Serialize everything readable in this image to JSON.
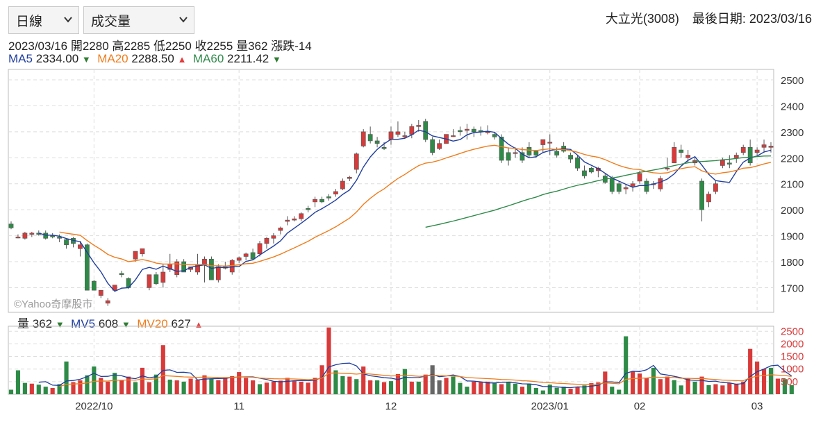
{
  "controls": {
    "period_select": "日線",
    "indicator_select": "成交量"
  },
  "header": {
    "stock": "大立光(3008)",
    "last_date": "最後日期: 2023/03/16"
  },
  "ohlc_line": {
    "date": "2023/03/16",
    "open": "開2280",
    "high": "高2285",
    "low": "低2250",
    "close": "收2255",
    "volume": "量362",
    "change": "漲跌-14"
  },
  "ma_line": {
    "ma5_label": "MA5",
    "ma5_value": "2334.00",
    "ma5_dir": "▼",
    "ma20_label": "MA20",
    "ma20_value": "2288.50",
    "ma20_dir": "▲",
    "ma60_label": "MA60",
    "ma60_value": "2211.42",
    "ma60_dir": "▼"
  },
  "vol_line": {
    "vol_label": "量",
    "vol_value": "362",
    "vol_dir": "▼",
    "mv5_label": "MV5",
    "mv5_value": "608",
    "mv5_dir": "▼",
    "mv20_label": "MV20",
    "mv20_value": "627",
    "mv20_dir": "▲"
  },
  "watermark": "©Yahoo奇摩股市",
  "colors": {
    "up": "#d83a3a",
    "down": "#2e8b47",
    "flat": "#666666",
    "ma5": "#1f3e9e",
    "ma20": "#f07c1b",
    "ma60": "#2f8a4a",
    "grid": "#dddddd"
  },
  "chart_data": {
    "type": "candlestick",
    "price_axis": {
      "ticks": [
        1700,
        1800,
        1900,
        2000,
        2100,
        2200,
        2300,
        2400,
        2500
      ],
      "range": [
        1605,
        2540
      ]
    },
    "volume_axis": {
      "ticks": [
        500,
        1000,
        1500,
        2000,
        2500
      ],
      "range": [
        0,
        2700
      ]
    },
    "x_labels": [
      {
        "label": "2022/10",
        "index": 12
      },
      {
        "label": "11",
        "index": 33
      },
      {
        "label": "12",
        "index": 55
      },
      {
        "label": "2023/01",
        "index": 78
      },
      {
        "label": "02",
        "index": 91
      },
      {
        "label": "03",
        "index": 108
      }
    ],
    "candles": [
      {
        "o": 1945,
        "h": 1955,
        "l": 1925,
        "c": 1930
      },
      {
        "o": 1895,
        "h": 1905,
        "l": 1890,
        "c": 1895
      },
      {
        "o": 1890,
        "h": 1915,
        "l": 1885,
        "c": 1910
      },
      {
        "o": 1905,
        "h": 1915,
        "l": 1895,
        "c": 1910
      },
      {
        "o": 1910,
        "h": 1920,
        "l": 1900,
        "c": 1905
      },
      {
        "o": 1910,
        "h": 1920,
        "l": 1885,
        "c": 1890
      },
      {
        "o": 1900,
        "h": 1910,
        "l": 1890,
        "c": 1895
      },
      {
        "o": 1895,
        "h": 1905,
        "l": 1875,
        "c": 1890
      },
      {
        "o": 1885,
        "h": 1890,
        "l": 1850,
        "c": 1865
      },
      {
        "o": 1890,
        "h": 1895,
        "l": 1855,
        "c": 1870
      },
      {
        "o": 1850,
        "h": 1880,
        "l": 1820,
        "c": 1865
      },
      {
        "o": 1865,
        "h": 1870,
        "l": 1690,
        "c": 1690
      },
      {
        "o": 1725,
        "h": 1730,
        "l": 1690,
        "c": 1690
      },
      {
        "o": 1670,
        "h": 1690,
        "l": 1660,
        "c": 1690
      },
      {
        "o": 1640,
        "h": 1660,
        "l": 1630,
        "c": 1650
      },
      {
        "o": 1690,
        "h": 1710,
        "l": 1685,
        "c": 1710
      },
      {
        "o": 1755,
        "h": 1765,
        "l": 1740,
        "c": 1750
      },
      {
        "o": 1735,
        "h": 1740,
        "l": 1695,
        "c": 1700
      },
      {
        "o": 1810,
        "h": 1840,
        "l": 1800,
        "c": 1840
      },
      {
        "o": 1830,
        "h": 1850,
        "l": 1820,
        "c": 1850
      },
      {
        "o": 1700,
        "h": 1740,
        "l": 1690,
        "c": 1750
      },
      {
        "o": 1750,
        "h": 1760,
        "l": 1710,
        "c": 1715
      },
      {
        "o": 1720,
        "h": 1790,
        "l": 1700,
        "c": 1760
      },
      {
        "o": 1770,
        "h": 1830,
        "l": 1760,
        "c": 1790
      },
      {
        "o": 1750,
        "h": 1810,
        "l": 1740,
        "c": 1800
      },
      {
        "o": 1800,
        "h": 1810,
        "l": 1760,
        "c": 1760
      },
      {
        "o": 1770,
        "h": 1780,
        "l": 1760,
        "c": 1780
      },
      {
        "o": 1760,
        "h": 1830,
        "l": 1750,
        "c": 1790
      },
      {
        "o": 1790,
        "h": 1820,
        "l": 1720,
        "c": 1810
      },
      {
        "o": 1810,
        "h": 1820,
        "l": 1730,
        "c": 1730
      },
      {
        "o": 1730,
        "h": 1790,
        "l": 1720,
        "c": 1780
      },
      {
        "o": 1780,
        "h": 1800,
        "l": 1770,
        "c": 1775
      },
      {
        "o": 1760,
        "h": 1810,
        "l": 1750,
        "c": 1805
      },
      {
        "o": 1805,
        "h": 1820,
        "l": 1795,
        "c": 1815
      },
      {
        "o": 1820,
        "h": 1835,
        "l": 1805,
        "c": 1830
      },
      {
        "o": 1835,
        "h": 1850,
        "l": 1805,
        "c": 1810
      },
      {
        "o": 1830,
        "h": 1880,
        "l": 1820,
        "c": 1870
      },
      {
        "o": 1870,
        "h": 1895,
        "l": 1850,
        "c": 1890
      },
      {
        "o": 1890,
        "h": 1910,
        "l": 1870,
        "c": 1900
      },
      {
        "o": 1920,
        "h": 1935,
        "l": 1905,
        "c": 1930
      },
      {
        "o": 1955,
        "h": 1975,
        "l": 1940,
        "c": 1960
      },
      {
        "o": 1960,
        "h": 1975,
        "l": 1955,
        "c": 1965
      },
      {
        "o": 1965,
        "h": 1990,
        "l": 1955,
        "c": 1985
      },
      {
        "o": 2005,
        "h": 2015,
        "l": 1990,
        "c": 2000
      },
      {
        "o": 2030,
        "h": 2050,
        "l": 2010,
        "c": 2040
      },
      {
        "o": 2040,
        "h": 2050,
        "l": 2025,
        "c": 2030
      },
      {
        "o": 2050,
        "h": 2060,
        "l": 2035,
        "c": 2045
      },
      {
        "o": 2060,
        "h": 2080,
        "l": 2050,
        "c": 2070
      },
      {
        "o": 2080,
        "h": 2120,
        "l": 2075,
        "c": 2110
      },
      {
        "o": 2120,
        "h": 2130,
        "l": 2110,
        "c": 2125
      },
      {
        "o": 2155,
        "h": 2220,
        "l": 2140,
        "c": 2215
      },
      {
        "o": 2245,
        "h": 2310,
        "l": 2240,
        "c": 2300
      },
      {
        "o": 2290,
        "h": 2320,
        "l": 2255,
        "c": 2265
      },
      {
        "o": 2265,
        "h": 2280,
        "l": 2240,
        "c": 2255
      },
      {
        "o": 2240,
        "h": 2260,
        "l": 2230,
        "c": 2235
      },
      {
        "o": 2270,
        "h": 2320,
        "l": 2250,
        "c": 2300
      },
      {
        "o": 2290,
        "h": 2340,
        "l": 2280,
        "c": 2300
      },
      {
        "o": 2280,
        "h": 2300,
        "l": 2275,
        "c": 2285
      },
      {
        "o": 2290,
        "h": 2330,
        "l": 2275,
        "c": 2320
      },
      {
        "o": 2320,
        "h": 2345,
        "l": 2300,
        "c": 2325
      },
      {
        "o": 2340,
        "h": 2350,
        "l": 2260,
        "c": 2270
      },
      {
        "o": 2270,
        "h": 2280,
        "l": 2210,
        "c": 2220
      },
      {
        "o": 2235,
        "h": 2270,
        "l": 2230,
        "c": 2255
      },
      {
        "o": 2255,
        "h": 2290,
        "l": 2255,
        "c": 2290
      },
      {
        "o": 2285,
        "h": 2310,
        "l": 2280,
        "c": 2285
      },
      {
        "o": 2305,
        "h": 2320,
        "l": 2285,
        "c": 2300
      },
      {
        "o": 2305,
        "h": 2330,
        "l": 2270,
        "c": 2310
      },
      {
        "o": 2310,
        "h": 2320,
        "l": 2280,
        "c": 2300
      },
      {
        "o": 2305,
        "h": 2320,
        "l": 2285,
        "c": 2300
      },
      {
        "o": 2300,
        "h": 2325,
        "l": 2290,
        "c": 2300
      },
      {
        "o": 2290,
        "h": 2300,
        "l": 2270,
        "c": 2280
      },
      {
        "o": 2280,
        "h": 2290,
        "l": 2180,
        "c": 2190
      },
      {
        "o": 2220,
        "h": 2240,
        "l": 2170,
        "c": 2190
      },
      {
        "o": 2220,
        "h": 2240,
        "l": 2200,
        "c": 2220
      },
      {
        "o": 2220,
        "h": 2240,
        "l": 2180,
        "c": 2190
      },
      {
        "o": 2240,
        "h": 2260,
        "l": 2200,
        "c": 2210
      },
      {
        "o": 2225,
        "h": 2230,
        "l": 2200,
        "c": 2210
      },
      {
        "o": 2250,
        "h": 2270,
        "l": 2220,
        "c": 2270
      },
      {
        "o": 2260,
        "h": 2290,
        "l": 2210,
        "c": 2260
      },
      {
        "o": 2225,
        "h": 2240,
        "l": 2200,
        "c": 2210
      },
      {
        "o": 2245,
        "h": 2260,
        "l": 2220,
        "c": 2225
      },
      {
        "o": 2210,
        "h": 2220,
        "l": 2180,
        "c": 2195
      },
      {
        "o": 2200,
        "h": 2210,
        "l": 2150,
        "c": 2160
      },
      {
        "o": 2150,
        "h": 2170,
        "l": 2120,
        "c": 2130
      },
      {
        "o": 2160,
        "h": 2165,
        "l": 2140,
        "c": 2145
      },
      {
        "o": 2150,
        "h": 2165,
        "l": 2125,
        "c": 2160
      },
      {
        "o": 2130,
        "h": 2140,
        "l": 2100,
        "c": 2105
      },
      {
        "o": 2120,
        "h": 2130,
        "l": 2060,
        "c": 2070
      },
      {
        "o": 2100,
        "h": 2110,
        "l": 2060,
        "c": 2070
      },
      {
        "o": 2080,
        "h": 2100,
        "l": 2060,
        "c": 2085
      },
      {
        "o": 2090,
        "h": 2110,
        "l": 2070,
        "c": 2100
      },
      {
        "o": 2110,
        "h": 2150,
        "l": 2100,
        "c": 2140
      },
      {
        "o": 2110,
        "h": 2120,
        "l": 2060,
        "c": 2070
      },
      {
        "o": 2100,
        "h": 2110,
        "l": 2080,
        "c": 2100
      },
      {
        "o": 2080,
        "h": 2130,
        "l": 2070,
        "c": 2120
      },
      {
        "o": 2160,
        "h": 2200,
        "l": 2150,
        "c": 2160
      },
      {
        "o": 2180,
        "h": 2260,
        "l": 2180,
        "c": 2240
      },
      {
        "o": 2230,
        "h": 2250,
        "l": 2200,
        "c": 2220
      },
      {
        "o": 2200,
        "h": 2230,
        "l": 2180,
        "c": 2210
      },
      {
        "o": 2180,
        "h": 2200,
        "l": 2170,
        "c": 2190
      },
      {
        "o": 2110,
        "h": 2120,
        "l": 1955,
        "c": 2000
      },
      {
        "o": 2030,
        "h": 2070,
        "l": 2010,
        "c": 2060
      },
      {
        "o": 2070,
        "h": 2110,
        "l": 2060,
        "c": 2100
      },
      {
        "o": 2170,
        "h": 2200,
        "l": 2160,
        "c": 2190
      },
      {
        "o": 2180,
        "h": 2210,
        "l": 2160,
        "c": 2175
      },
      {
        "o": 2200,
        "h": 2220,
        "l": 2180,
        "c": 2210
      },
      {
        "o": 2220,
        "h": 2250,
        "l": 2210,
        "c": 2240
      },
      {
        "o": 2240,
        "h": 2270,
        "l": 2170,
        "c": 2180
      },
      {
        "o": 2220,
        "h": 2240,
        "l": 2210,
        "c": 2230
      },
      {
        "o": 2240,
        "h": 2270,
        "l": 2220,
        "c": 2250
      },
      {
        "o": 2240,
        "h": 2260,
        "l": 2220,
        "c": 2245
      }
    ],
    "volumes": [
      {
        "v": 180,
        "d": "down"
      },
      {
        "v": 950,
        "d": "down"
      },
      {
        "v": 450,
        "d": "down"
      },
      {
        "v": 420,
        "d": "up"
      },
      {
        "v": 380,
        "d": "down"
      },
      {
        "v": 300,
        "d": "down"
      },
      {
        "v": 250,
        "d": "up"
      },
      {
        "v": 400,
        "d": "down"
      },
      {
        "v": 1300,
        "d": "down"
      },
      {
        "v": 480,
        "d": "up"
      },
      {
        "v": 550,
        "d": "up"
      },
      {
        "v": 750,
        "d": "down"
      },
      {
        "v": 1100,
        "d": "down"
      },
      {
        "v": 650,
        "d": "up"
      },
      {
        "v": 500,
        "d": "up"
      },
      {
        "v": 850,
        "d": "down"
      },
      {
        "v": 560,
        "d": "up"
      },
      {
        "v": 700,
        "d": "up"
      },
      {
        "v": 480,
        "d": "down"
      },
      {
        "v": 1050,
        "d": "up"
      },
      {
        "v": 480,
        "d": "up"
      },
      {
        "v": 780,
        "d": "down"
      },
      {
        "v": 1950,
        "d": "up"
      },
      {
        "v": 580,
        "d": "down"
      },
      {
        "v": 550,
        "d": "up"
      },
      {
        "v": 500,
        "d": "down"
      },
      {
        "v": 620,
        "d": "up"
      },
      {
        "v": 580,
        "d": "up"
      },
      {
        "v": 750,
        "d": "up"
      },
      {
        "v": 620,
        "d": "down"
      },
      {
        "v": 560,
        "d": "up"
      },
      {
        "v": 650,
        "d": "up"
      },
      {
        "v": 720,
        "d": "up"
      },
      {
        "v": 880,
        "d": "up"
      },
      {
        "v": 650,
        "d": "up"
      },
      {
        "v": 550,
        "d": "up"
      },
      {
        "v": 400,
        "d": "down"
      },
      {
        "v": 460,
        "d": "up"
      },
      {
        "v": 500,
        "d": "up"
      },
      {
        "v": 540,
        "d": "up"
      },
      {
        "v": 650,
        "d": "up"
      },
      {
        "v": 540,
        "d": "up"
      },
      {
        "v": 500,
        "d": "up"
      },
      {
        "v": 460,
        "d": "up"
      },
      {
        "v": 650,
        "d": "up"
      },
      {
        "v": 1150,
        "d": "up"
      },
      {
        "v": 2650,
        "d": "up"
      },
      {
        "v": 950,
        "d": "down"
      },
      {
        "v": 720,
        "d": "down"
      },
      {
        "v": 700,
        "d": "up"
      },
      {
        "v": 600,
        "d": "down"
      },
      {
        "v": 1100,
        "d": "up"
      },
      {
        "v": 550,
        "d": "up"
      },
      {
        "v": 550,
        "d": "down"
      },
      {
        "v": 480,
        "d": "up"
      },
      {
        "v": 520,
        "d": "down"
      },
      {
        "v": 800,
        "d": "up"
      },
      {
        "v": 1000,
        "d": "down"
      },
      {
        "v": 500,
        "d": "up"
      },
      {
        "v": 500,
        "d": "down"
      },
      {
        "v": 780,
        "d": "up"
      },
      {
        "v": 1150,
        "d": "flat"
      },
      {
        "v": 550,
        "d": "flat"
      },
      {
        "v": 650,
        "d": "up"
      },
      {
        "v": 700,
        "d": "down"
      },
      {
        "v": 450,
        "d": "down"
      },
      {
        "v": 300,
        "d": "down"
      },
      {
        "v": 500,
        "d": "up"
      },
      {
        "v": 500,
        "d": "up"
      },
      {
        "v": 500,
        "d": "up"
      },
      {
        "v": 450,
        "d": "down"
      },
      {
        "v": 400,
        "d": "up"
      },
      {
        "v": 500,
        "d": "down"
      },
      {
        "v": 420,
        "d": "down"
      },
      {
        "v": 300,
        "d": "up"
      },
      {
        "v": 420,
        "d": "down"
      },
      {
        "v": 250,
        "d": "down"
      },
      {
        "v": 150,
        "d": "down"
      },
      {
        "v": 380,
        "d": "down"
      },
      {
        "v": 260,
        "d": "down"
      },
      {
        "v": 300,
        "d": "down"
      },
      {
        "v": 220,
        "d": "up"
      },
      {
        "v": 300,
        "d": "up"
      },
      {
        "v": 350,
        "d": "down"
      },
      {
        "v": 440,
        "d": "up"
      },
      {
        "v": 470,
        "d": "up"
      },
      {
        "v": 900,
        "d": "up"
      },
      {
        "v": 300,
        "d": "down"
      },
      {
        "v": 180,
        "d": "down"
      },
      {
        "v": 2300,
        "d": "down"
      },
      {
        "v": 900,
        "d": "up"
      },
      {
        "v": 820,
        "d": "up"
      },
      {
        "v": 650,
        "d": "up"
      },
      {
        "v": 1050,
        "d": "down"
      },
      {
        "v": 600,
        "d": "up"
      },
      {
        "v": 700,
        "d": "up"
      },
      {
        "v": 560,
        "d": "down"
      },
      {
        "v": 350,
        "d": "down"
      },
      {
        "v": 640,
        "d": "up"
      },
      {
        "v": 500,
        "d": "down"
      },
      {
        "v": 700,
        "d": "up"
      },
      {
        "v": 360,
        "d": "down"
      },
      {
        "v": 400,
        "d": "up"
      },
      {
        "v": 350,
        "d": "up"
      },
      {
        "v": 450,
        "d": "up"
      },
      {
        "v": 420,
        "d": "up"
      },
      {
        "v": 500,
        "d": "up"
      },
      {
        "v": 1800,
        "d": "up"
      },
      {
        "v": 1300,
        "d": "up"
      },
      {
        "v": 1000,
        "d": "up"
      },
      {
        "v": 1050,
        "d": "down"
      },
      {
        "v": 620,
        "d": "up"
      },
      {
        "v": 600,
        "d": "down"
      },
      {
        "v": 362,
        "d": "down"
      }
    ]
  }
}
